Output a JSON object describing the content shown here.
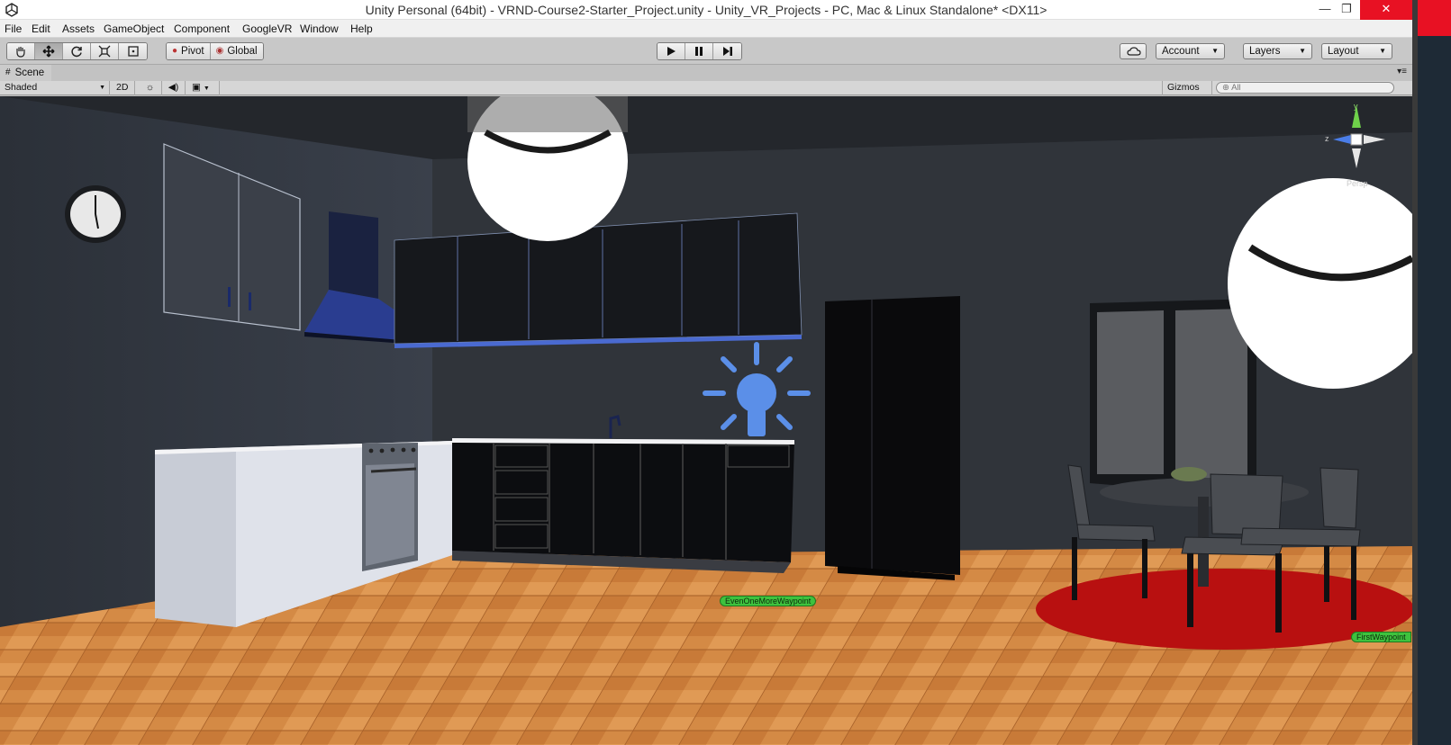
{
  "window": {
    "title": "Unity Personal (64bit) - VRND-Course2-Starter_Project.unity - Unity_VR_Projects - PC, Mac & Linux Standalone* <DX11>",
    "controls": [
      "—",
      "❐",
      "✕"
    ]
  },
  "menu": [
    "File",
    "Edit",
    "Assets",
    "GameObject",
    "Component",
    "GoogleVR",
    "Window",
    "Help"
  ],
  "toolbar": {
    "transform_tools": [
      "hand-icon",
      "move-icon",
      "rotate-icon",
      "scale-icon",
      "rect-icon"
    ],
    "pivot_label": "Pivot",
    "global_label": "Global",
    "play_controls": [
      "play-icon",
      "pause-icon",
      "step-icon"
    ],
    "account_label": "Account",
    "layers_label": "Layers",
    "layout_label": "Layout"
  },
  "scene_tab": {
    "label": "Scene"
  },
  "scene_toolbar": {
    "shading_mode": "Shaded",
    "mode_2d": "2D",
    "gizmos_label": "Gizmos",
    "search_placeholder": "All"
  },
  "scene_gizmo": {
    "y_label": "y",
    "z_label": "z",
    "projection_label": "Persp"
  },
  "waypoints": [
    {
      "name": "EvenOneMoreWaypoint"
    },
    {
      "name": "FirstWaypoint"
    }
  ],
  "colors": {
    "waypoint_tag": "#3ec23e",
    "light_icon": "#5b8fe8",
    "floor": "#d48a45",
    "rug": "#b81010"
  }
}
